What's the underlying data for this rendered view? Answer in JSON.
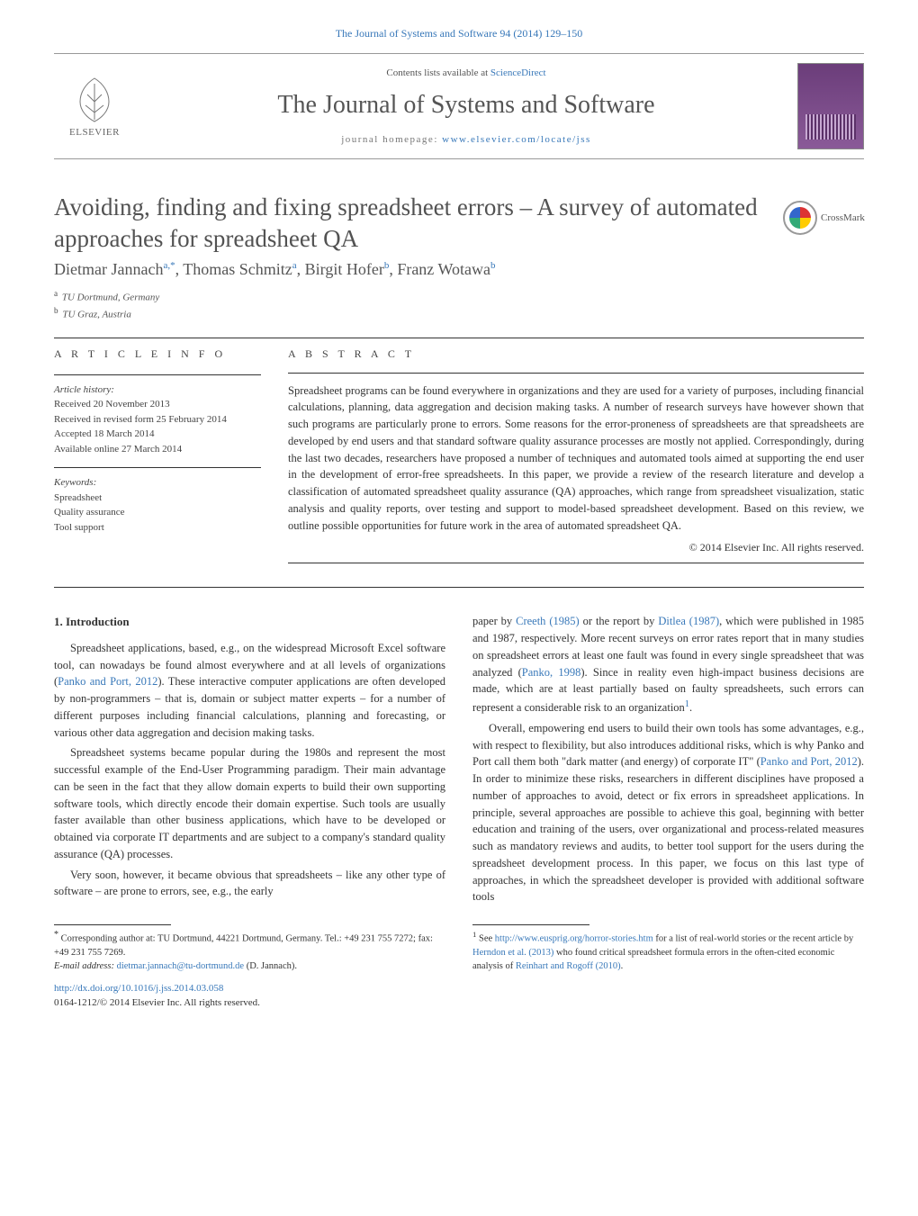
{
  "journal_ref": "The Journal of Systems and Software 94 (2014) 129–150",
  "header": {
    "contents_prefix": "Contents lists available at ",
    "contents_link": "ScienceDirect",
    "journal_name": "The Journal of Systems and Software",
    "homepage_prefix": "journal homepage: ",
    "homepage_link": "www.elsevier.com/locate/jss",
    "elsevier": "ELSEVIER"
  },
  "crossmark": "CrossMark",
  "title": "Avoiding, finding and fixing spreadsheet errors – A survey of automated approaches for spreadsheet QA",
  "authors_html": "Dietmar Jannach",
  "authors": [
    {
      "name": "Dietmar Jannach",
      "sup": "a,*"
    },
    {
      "name": "Thomas Schmitz",
      "sup": "a"
    },
    {
      "name": "Birgit Hofer",
      "sup": "b"
    },
    {
      "name": "Franz Wotawa",
      "sup": "b"
    }
  ],
  "affiliations": [
    {
      "sup": "a",
      "text": "TU Dortmund, Germany"
    },
    {
      "sup": "b",
      "text": "TU Graz, Austria"
    }
  ],
  "article_info": {
    "label": "a r t i c l e   i n f o",
    "history_head": "Article history:",
    "history": [
      "Received 20 November 2013",
      "Received in revised form 25 February 2014",
      "Accepted 18 March 2014",
      "Available online 27 March 2014"
    ],
    "keywords_head": "Keywords:",
    "keywords": [
      "Spreadsheet",
      "Quality assurance",
      "Tool support"
    ]
  },
  "abstract": {
    "label": "a b s t r a c t",
    "text": "Spreadsheet programs can be found everywhere in organizations and they are used for a variety of purposes, including financial calculations, planning, data aggregation and decision making tasks. A number of research surveys have however shown that such programs are particularly prone to errors. Some reasons for the error-proneness of spreadsheets are that spreadsheets are developed by end users and that standard software quality assurance processes are mostly not applied. Correspondingly, during the last two decades, researchers have proposed a number of techniques and automated tools aimed at supporting the end user in the development of error-free spreadsheets. In this paper, we provide a review of the research literature and develop a classification of automated spreadsheet quality assurance (QA) approaches, which range from spreadsheet visualization, static analysis and quality reports, over testing and support to model-based spreadsheet development. Based on this review, we outline possible opportunities for future work in the area of automated spreadsheet QA.",
    "copyright": "© 2014 Elsevier Inc. All rights reserved."
  },
  "body": {
    "heading1": "1.  Introduction",
    "para1": "Spreadsheet applications, based, e.g., on the widespread Microsoft Excel software tool, can nowadays be found almost everywhere and at all levels of organizations (",
    "para1_link": "Panko and Port, 2012",
    "para1b": "). These interactive computer applications are often developed by non-programmers – that is, domain or subject matter experts – for a number of different purposes including financial calculations, planning and forecasting, or various other data aggregation and decision making tasks.",
    "para2": "Spreadsheet systems became popular during the 1980s and represent the most successful example of the End-User Programming paradigm. Their main advantage can be seen in the fact that they allow domain experts to build their own supporting software tools, which directly encode their domain expertise. Such tools are usually faster available than other business applications, which have to be developed or obtained via corporate IT departments and are subject to a company's standard quality assurance (QA) processes.",
    "para3": "Very soon, however, it became obvious that spreadsheets – like any other type of software – are prone to errors, see, e.g., the early",
    "para4a": "paper by ",
    "para4_link1": "Creeth (1985)",
    "para4b": " or the report by ",
    "para4_link2": "Ditlea (1987)",
    "para4c": ", which were published in 1985 and 1987, respectively. More recent surveys on error rates report that in many studies on spreadsheet errors at least one fault was found in every single spreadsheet that was analyzed (",
    "para4_link3": "Panko, 1998",
    "para4d": "). Since in reality even high-impact business decisions are made, which are at least partially based on faulty spreadsheets, such errors can represent a considerable risk to an organization",
    "para4_sup": "1",
    "para4e": ".",
    "para5a": "Overall, empowering end users to build their own tools has some advantages, e.g., with respect to flexibility, but also introduces additional risks, which is why Panko and Port call them both \"dark matter (and energy) of corporate IT\" (",
    "para5_link": "Panko and Port, 2012",
    "para5b": "). In order to minimize these risks, researchers in different disciplines have proposed a number of approaches to avoid, detect or fix errors in spreadsheet applications. In principle, several approaches are possible to achieve this goal, beginning with better education and training of the users, over organizational and process-related measures such as mandatory reviews and audits, to better tool support for the users during the spreadsheet development process. In this paper, we focus on this last type of approaches, in which the spreadsheet developer is provided with additional software tools"
  },
  "footnotes": {
    "left": {
      "star": "*",
      "text": " Corresponding author at: TU Dortmund, 44221 Dortmund, Germany. Tel.: +49 231 755 7272; fax: +49 231 755 7269.",
      "email_label": "E-mail address: ",
      "email": "dietmar.jannach@tu-dortmund.de",
      "email_suffix": " (D. Jannach)."
    },
    "right": {
      "num": "1",
      "a": " See ",
      "link1": "http://www.eusprig.org/horror-stories.htm",
      "b": " for a list of real-world stories or the recent article by ",
      "link2": "Herndon et al. (2013)",
      "c": " who found critical spreadsheet formula errors in the often-cited economic analysis of ",
      "link3": "Reinhart and Rogoff (2010)",
      "d": "."
    }
  },
  "doi": {
    "link": "http://dx.doi.org/10.1016/j.jss.2014.03.058",
    "issn": "0164-1212/© 2014 Elsevier Inc. All rights reserved."
  }
}
